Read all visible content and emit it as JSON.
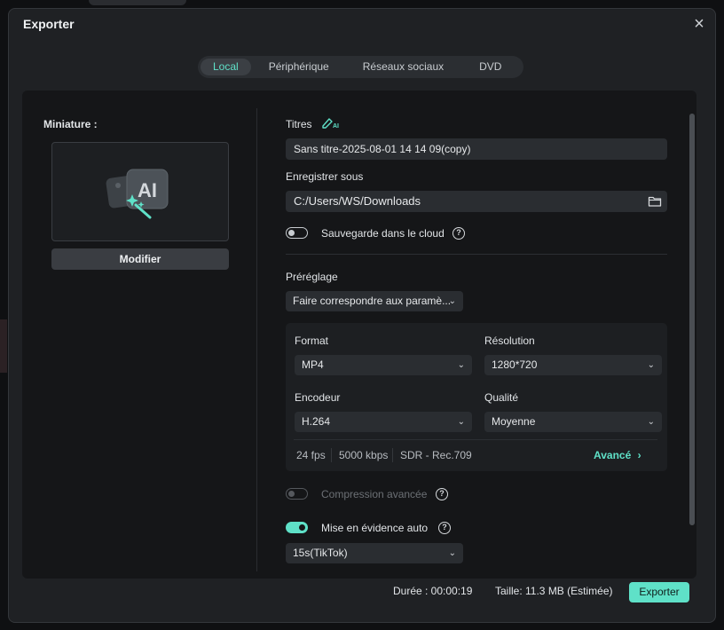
{
  "window": {
    "title": "Exporter",
    "close_label": "×"
  },
  "tabs": [
    {
      "label": "Local",
      "active": true
    },
    {
      "label": "Périphérique",
      "active": false
    },
    {
      "label": "Réseaux sociaux",
      "active": false
    },
    {
      "label": "DVD",
      "active": false
    }
  ],
  "thumbnail": {
    "label": "Miniature :",
    "ai_text": "AI",
    "modify_button": "Modifier"
  },
  "titles": {
    "label": "Titres",
    "ai_badge": "AI",
    "value": "Sans titre-2025-08-01 14 14 09(copy)"
  },
  "save_as": {
    "label": "Enregistrer sous",
    "path": "C:/Users/WS/Downloads"
  },
  "cloud_backup": {
    "label": "Sauvegarde dans le cloud",
    "enabled": false,
    "help": "?"
  },
  "preset": {
    "label": "Préréglage",
    "selected": "Faire correspondre aux paramè..."
  },
  "settings": {
    "format": {
      "label": "Format",
      "selected": "MP4"
    },
    "resolution": {
      "label": "Résolution",
      "selected": "1280*720"
    },
    "encoder": {
      "label": "Encodeur",
      "selected": "H.264"
    },
    "quality": {
      "label": "Qualité",
      "selected": "Moyenne"
    },
    "fps": "24 fps",
    "bitrate": "5000 kbps",
    "color_space": "SDR - Rec.709",
    "advanced_link": "Avancé",
    "advanced_chevron": "›"
  },
  "advanced_compression": {
    "label": "Compression avancée",
    "enabled": false,
    "disabled": true,
    "help": "?"
  },
  "auto_highlight": {
    "label": "Mise en évidence auto",
    "enabled": true,
    "help": "?",
    "duration_selected": "15s(TikTok)"
  },
  "footer": {
    "duration": "Durée : 00:00:19",
    "size": "Taille: 11.3 MB (Estimée)",
    "export_button": "Exporter"
  },
  "colors": {
    "accent": "#5fe1c8",
    "background": "#1f2124",
    "panel": "#151618"
  },
  "chevron": "⌄"
}
